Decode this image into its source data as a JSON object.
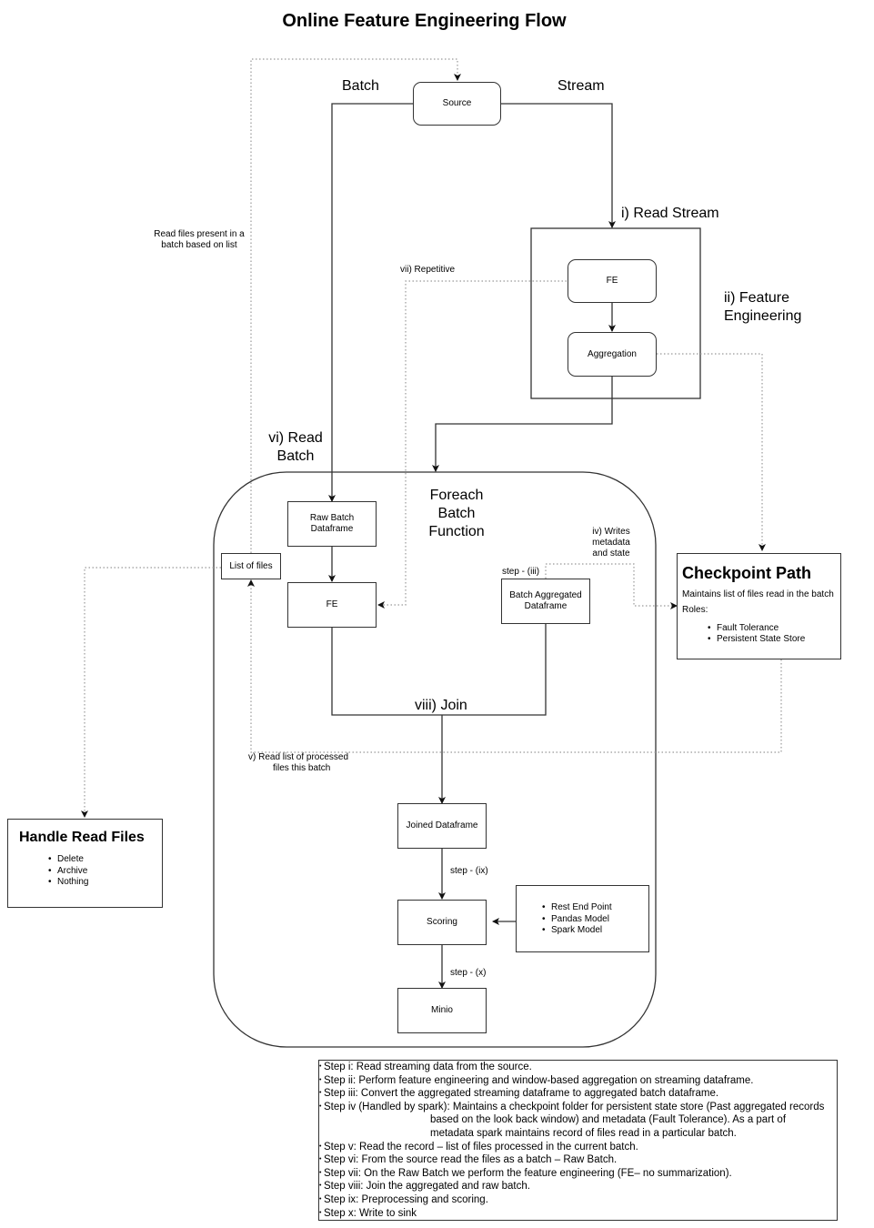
{
  "title": "Online Feature Engineering Flow",
  "colors": {
    "line": "#333333",
    "dotted": "#999999",
    "background": "#ffffff"
  },
  "labels": {
    "batch": "Batch",
    "stream": "Stream",
    "read_stream": "i) Read Stream",
    "feature_engineering": [
      "ii) Feature",
      "Engineering"
    ],
    "read_batch": [
      "vi) Read",
      "Batch"
    ],
    "foreach": [
      "Foreach",
      "Batch",
      "Function"
    ],
    "join": "viii) Join",
    "repetitive": "vii) Repetitive",
    "read_files_list": [
      "Read files present in a",
      "batch based on list"
    ],
    "writes_metadata": [
      "iv) Writes",
      "metadata",
      "and state"
    ],
    "step_iii": "step - (iii)",
    "read_processed": [
      "v) Read list of processed",
      "files this batch"
    ],
    "step_ix": "step - (ix)",
    "step_x": "step - (x)"
  },
  "nodes": {
    "source": "Source",
    "stream_fe": "FE",
    "aggregation": "Aggregation",
    "raw_batch": [
      "Raw Batch",
      "Dataframe"
    ],
    "list_of_files": "List of files",
    "batch_fe": "FE",
    "batch_aggregated": [
      "Batch Aggregated",
      "Dataframe"
    ],
    "joined": "Joined Dataframe",
    "scoring": "Scoring",
    "minio": "Minio"
  },
  "scoring_options": [
    "Rest End Point",
    "Pandas Model",
    "Spark Model"
  ],
  "checkpoint": {
    "title": "Checkpoint Path",
    "description": "Maintains list of files read in the batch",
    "roles_label": "Roles:",
    "roles": [
      "Fault Tolerance",
      "Persistent State Store"
    ]
  },
  "handle_read_files": {
    "title": "Handle Read Files",
    "options": [
      "Delete",
      "Archive",
      "Nothing"
    ]
  },
  "steps": [
    {
      "text": "Step i: Read streaming data from the source."
    },
    {
      "text": "Step ii: Perform feature engineering and window-based aggregation on streaming dataframe."
    },
    {
      "text": "Step iii: Convert the aggregated streaming dataframe to aggregated batch dataframe."
    },
    {
      "text": "Step iv (Handled by spark): Maintains a checkpoint folder for persistent state store (Past aggregated records",
      "cont": [
        "based on the look back window) and metadata (Fault Tolerance). As a part of",
        "metadata spark maintains record of files read in a particular batch."
      ]
    },
    {
      "text": "Step v: Read the record – list of files processed in the current batch."
    },
    {
      "text": "Step vi: From the source read the files as a batch – Raw Batch."
    },
    {
      "text": "Step vii: On the Raw Batch we perform the feature engineering (FE– no summarization)."
    },
    {
      "text": "Step viii: Join the aggregated and raw batch."
    },
    {
      "text": "Step ix: Preprocessing and scoring."
    },
    {
      "text": "Step x: Write to sink"
    }
  ]
}
